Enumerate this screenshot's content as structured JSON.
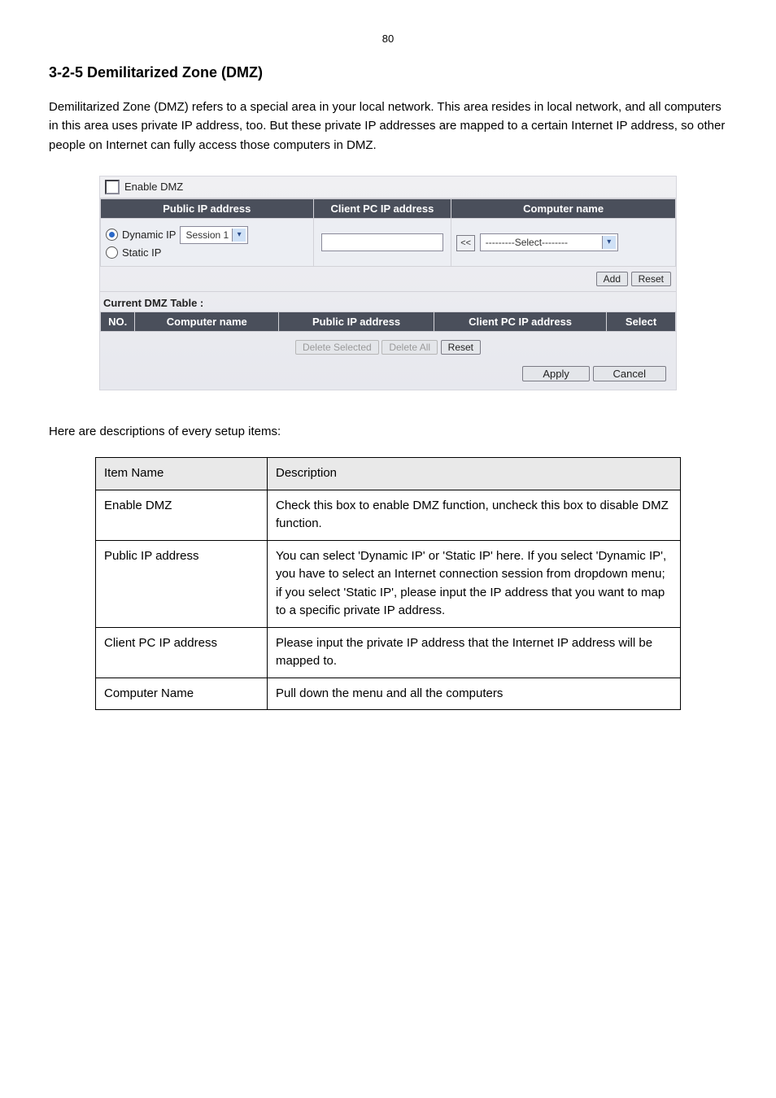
{
  "page_number": "80",
  "section_title": "3-2-5 Demilitarized Zone (DMZ)",
  "intro": "Demilitarized Zone (DMZ) refers to a special area in your local network. This area resides in local network, and all computers in this area uses private IP address, too. But these private IP addresses are mapped to a certain Internet IP address, so other people on Internet can fully access those computers in DMZ.",
  "shot": {
    "enable_label": "Enable DMZ",
    "top_headers": {
      "public_ip": "Public IP address",
      "client_ip": "Client PC IP address",
      "computer_name": "Computer name"
    },
    "radios": {
      "dynamic_label": "Dynamic IP",
      "static_label": "Static IP"
    },
    "session_dd": "Session 1",
    "assign_btn": "<<",
    "select_dd": "---------Select--------",
    "btn_add": "Add",
    "btn_reset": "Reset",
    "sub_heading": "Current DMZ Table :",
    "tbl2_headers": {
      "no": "NO.",
      "computer_name": "Computer name",
      "public_ip": "Public IP address",
      "client_ip": "Client PC IP address",
      "select": "Select"
    },
    "btn_delete_selected": "Delete Selected",
    "btn_delete_all": "Delete All",
    "btn_reset2": "Reset",
    "btn_apply": "Apply",
    "btn_cancel": "Cancel"
  },
  "note": "Here are descriptions of every setup items:",
  "desc_table": {
    "header": {
      "item": "Item Name",
      "desc": "Description"
    },
    "rows": [
      {
        "item": "Enable DMZ",
        "desc": "Check this box to enable DMZ function, uncheck this box to disable DMZ function."
      },
      {
        "item": "Public IP address",
        "desc": "You can select 'Dynamic IP' or 'Static IP' here. If you select 'Dynamic IP', you have to select an Internet connection session from dropdown menu; if you select 'Static IP', please input the IP address that you want to map to a specific private IP address."
      },
      {
        "item": "Client PC IP address",
        "desc": "Please input the private IP address that the Internet IP address will be mapped to."
      },
      {
        "item": "Computer Name",
        "desc": "Pull down the menu and all the computers"
      }
    ]
  }
}
